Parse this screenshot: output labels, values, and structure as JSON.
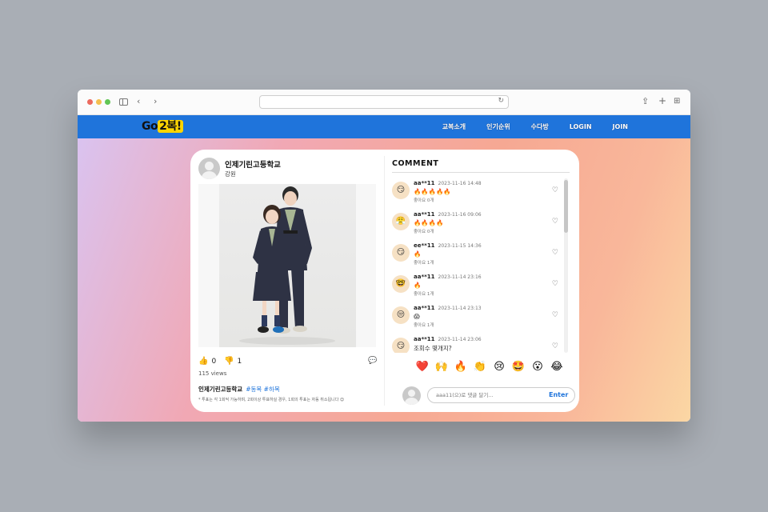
{
  "site": {
    "logo_left": "Go",
    "logo_right": "2복!",
    "nav": [
      "교복소개",
      "인기순위",
      "수다방",
      "LOGIN",
      "JOIN"
    ]
  },
  "post": {
    "school": "인제기린고등학교",
    "region": "강원",
    "likes": "0",
    "dislikes": "1",
    "views": "115 views",
    "caption_school": "인제기린고등학교",
    "tags": "#동복 #하복",
    "notice": "* 투표는 각 1회씩 가능하며, 2회이상 투표하실 경우, 1회의 투표는 자동 취소됩니다 😊"
  },
  "comments": {
    "title": "COMMENT",
    "items": [
      {
        "face": "😏",
        "user": "aa**11",
        "time": "2023-11-16 14:48",
        "text": "🔥🔥🔥🔥🔥",
        "likes": "좋아요 0개"
      },
      {
        "face": "😤",
        "user": "aa**11",
        "time": "2023-11-16 09:06",
        "text": "🔥🔥🔥🔥",
        "likes": "좋아요 0개"
      },
      {
        "face": "😏",
        "user": "ee**11",
        "time": "2023-11-15 14:36",
        "text": "🔥",
        "likes": "좋아요 1개"
      },
      {
        "face": "🤓",
        "user": "aa**11",
        "time": "2023-11-14 23:16",
        "text": "🔥",
        "likes": "좋아요 1개"
      },
      {
        "face": "😒",
        "user": "aa**11",
        "time": "2023-11-14 23:13",
        "text": "😱",
        "likes": "좋아요 1개"
      },
      {
        "face": "😏",
        "user": "aa**11",
        "time": "2023-11-14 23:06",
        "text": "조회수 몇개지?",
        "likes": ""
      }
    ],
    "reactions": [
      "❤️",
      "🙌",
      "🔥",
      "👏",
      "😢",
      "🤩",
      "😮",
      "😂"
    ],
    "input_placeholder": "aaa11(으)로 댓글 달기...",
    "enter_label": "Enter"
  }
}
